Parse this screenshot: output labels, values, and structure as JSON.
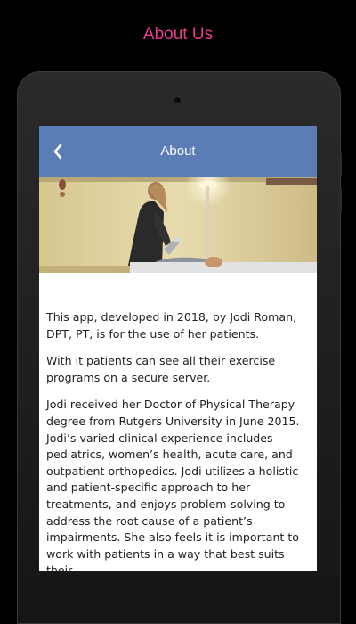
{
  "promo": {
    "title": "About Us"
  },
  "appbar": {
    "title": "About",
    "back_icon": "chevron-left-icon"
  },
  "colors": {
    "accent_pink": "#e83e8c",
    "appbar_blue": "#5b7db5"
  },
  "content": {
    "paragraphs": [
      "This app, developed in 2018, by Jodi Roman, DPT, PT,  is for the use of her patients.",
      "With it patients can see all their exercise programs on a secure server.",
      "Jodi received her Doctor of Physical Therapy degree from Rutgers University in June 2015. Jodi’s varied clinical experience includes pediatrics, women’s health, acute care, and outpatient orthopedics. Jodi utilizes a holistic and patient-specific approach to her treatments, and enjoys problem-solving to address the root cause of a patient’s impairments. She also feels it is important to work with patients in a way that best suits their"
    ]
  }
}
